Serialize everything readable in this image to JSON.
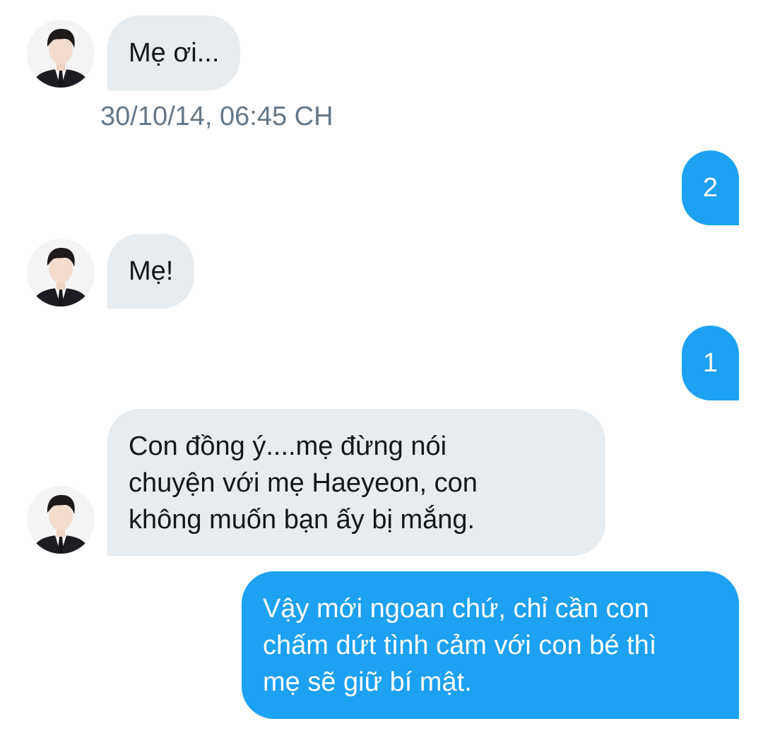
{
  "conversation": {
    "messages": [
      {
        "direction": "incoming",
        "text": "Mẹ ơi..."
      },
      {
        "direction": "outgoing",
        "text": "2"
      },
      {
        "direction": "incoming",
        "text": "Mẹ!"
      },
      {
        "direction": "outgoing",
        "text": "1"
      },
      {
        "direction": "incoming",
        "text": "Con đồng ý....mẹ đừng nói\nchuyện với mẹ Haeyeon, con\nkhông muốn bạn ấy bị mắng."
      },
      {
        "direction": "outgoing",
        "text": "Vậy mới ngoan chứ, chỉ cần con\nchấm dứt tình cảm với con bé thì\nmẹ sẽ giữ bí mật."
      }
    ],
    "timestamp": "30/10/14, 06:45 CH"
  },
  "colors": {
    "incoming_bubble": "#e6ecf0",
    "outgoing_bubble": "#1da1f2",
    "timestamp_text": "#657786"
  },
  "icons": {
    "avatar": "profile-photo-avatar"
  }
}
